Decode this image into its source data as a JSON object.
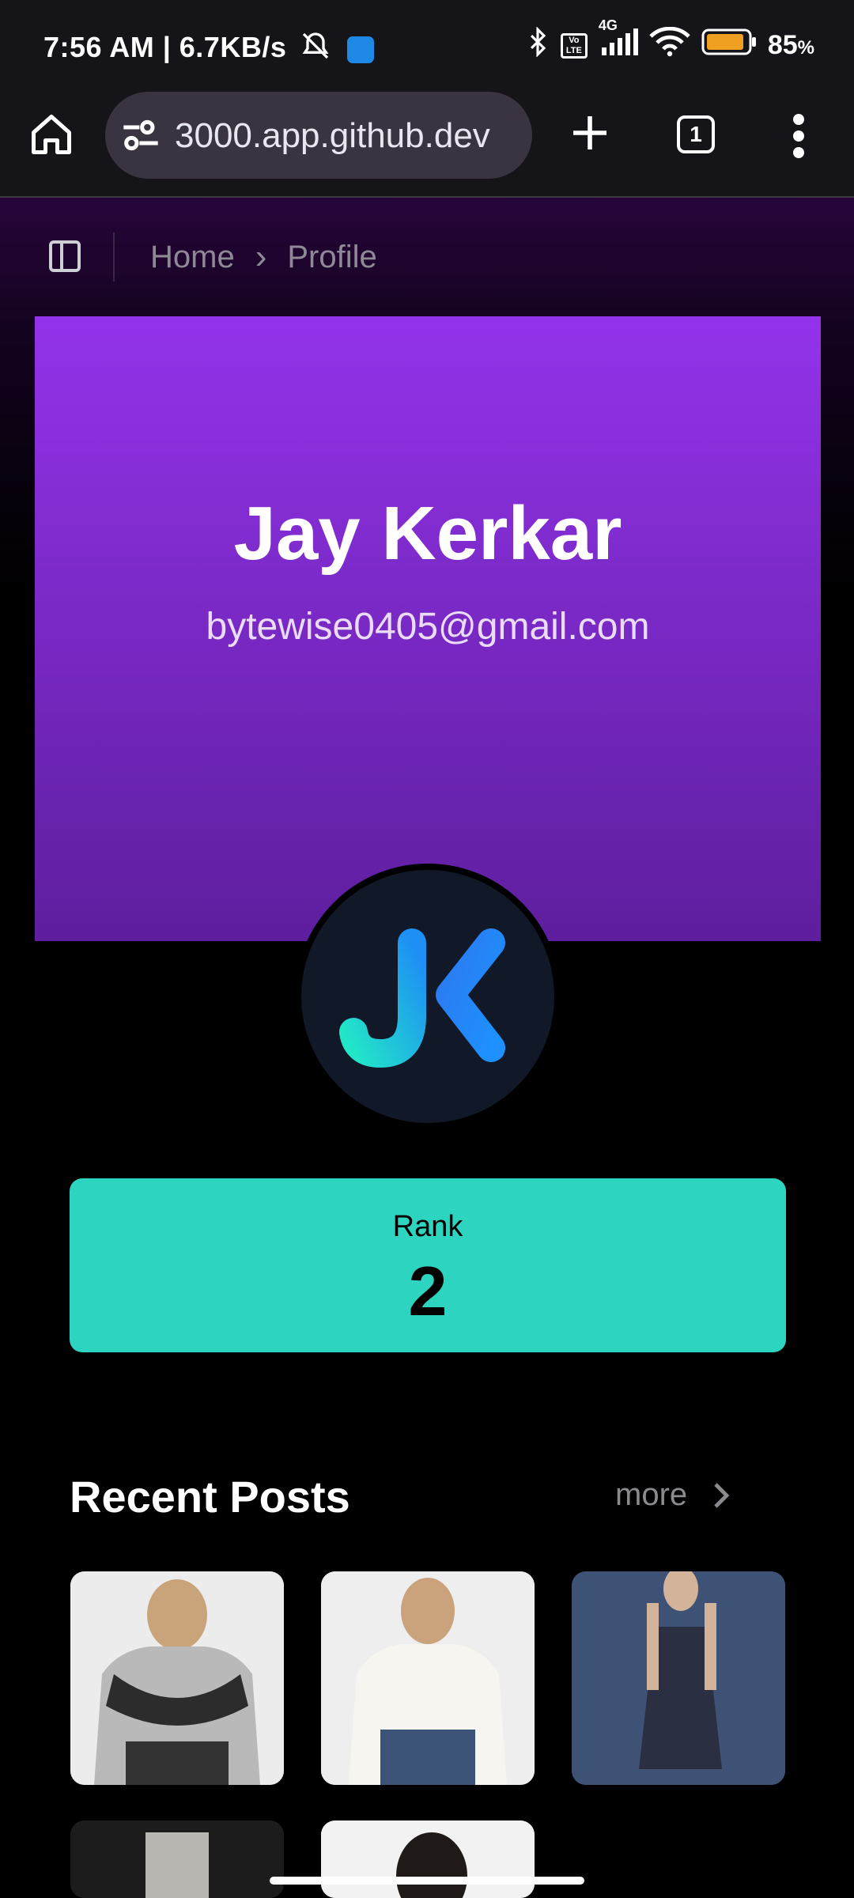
{
  "status_bar": {
    "time_speed": "7:56 AM | 6.7KB/s",
    "network_label": "4G",
    "volte_label": "Vo LTE",
    "battery_percent": "85",
    "battery_unit": "%"
  },
  "browser": {
    "url": "3000.app.github.dev",
    "tab_count": "1"
  },
  "breadcrumb": {
    "home": "Home",
    "separator": "›",
    "current": "Profile"
  },
  "profile": {
    "name": "Jay Kerkar",
    "email": "bytewise0405@gmail.com",
    "avatar_initials": "JK"
  },
  "rank": {
    "label": "Rank",
    "value": "2"
  },
  "recent_posts": {
    "title": "Recent Posts",
    "more_label": "more"
  },
  "colors": {
    "hero_top": "#9333ea",
    "hero_bottom": "#5e1e9e",
    "rank_bg": "#2dd4bf",
    "avatar_bg": "#111827"
  }
}
